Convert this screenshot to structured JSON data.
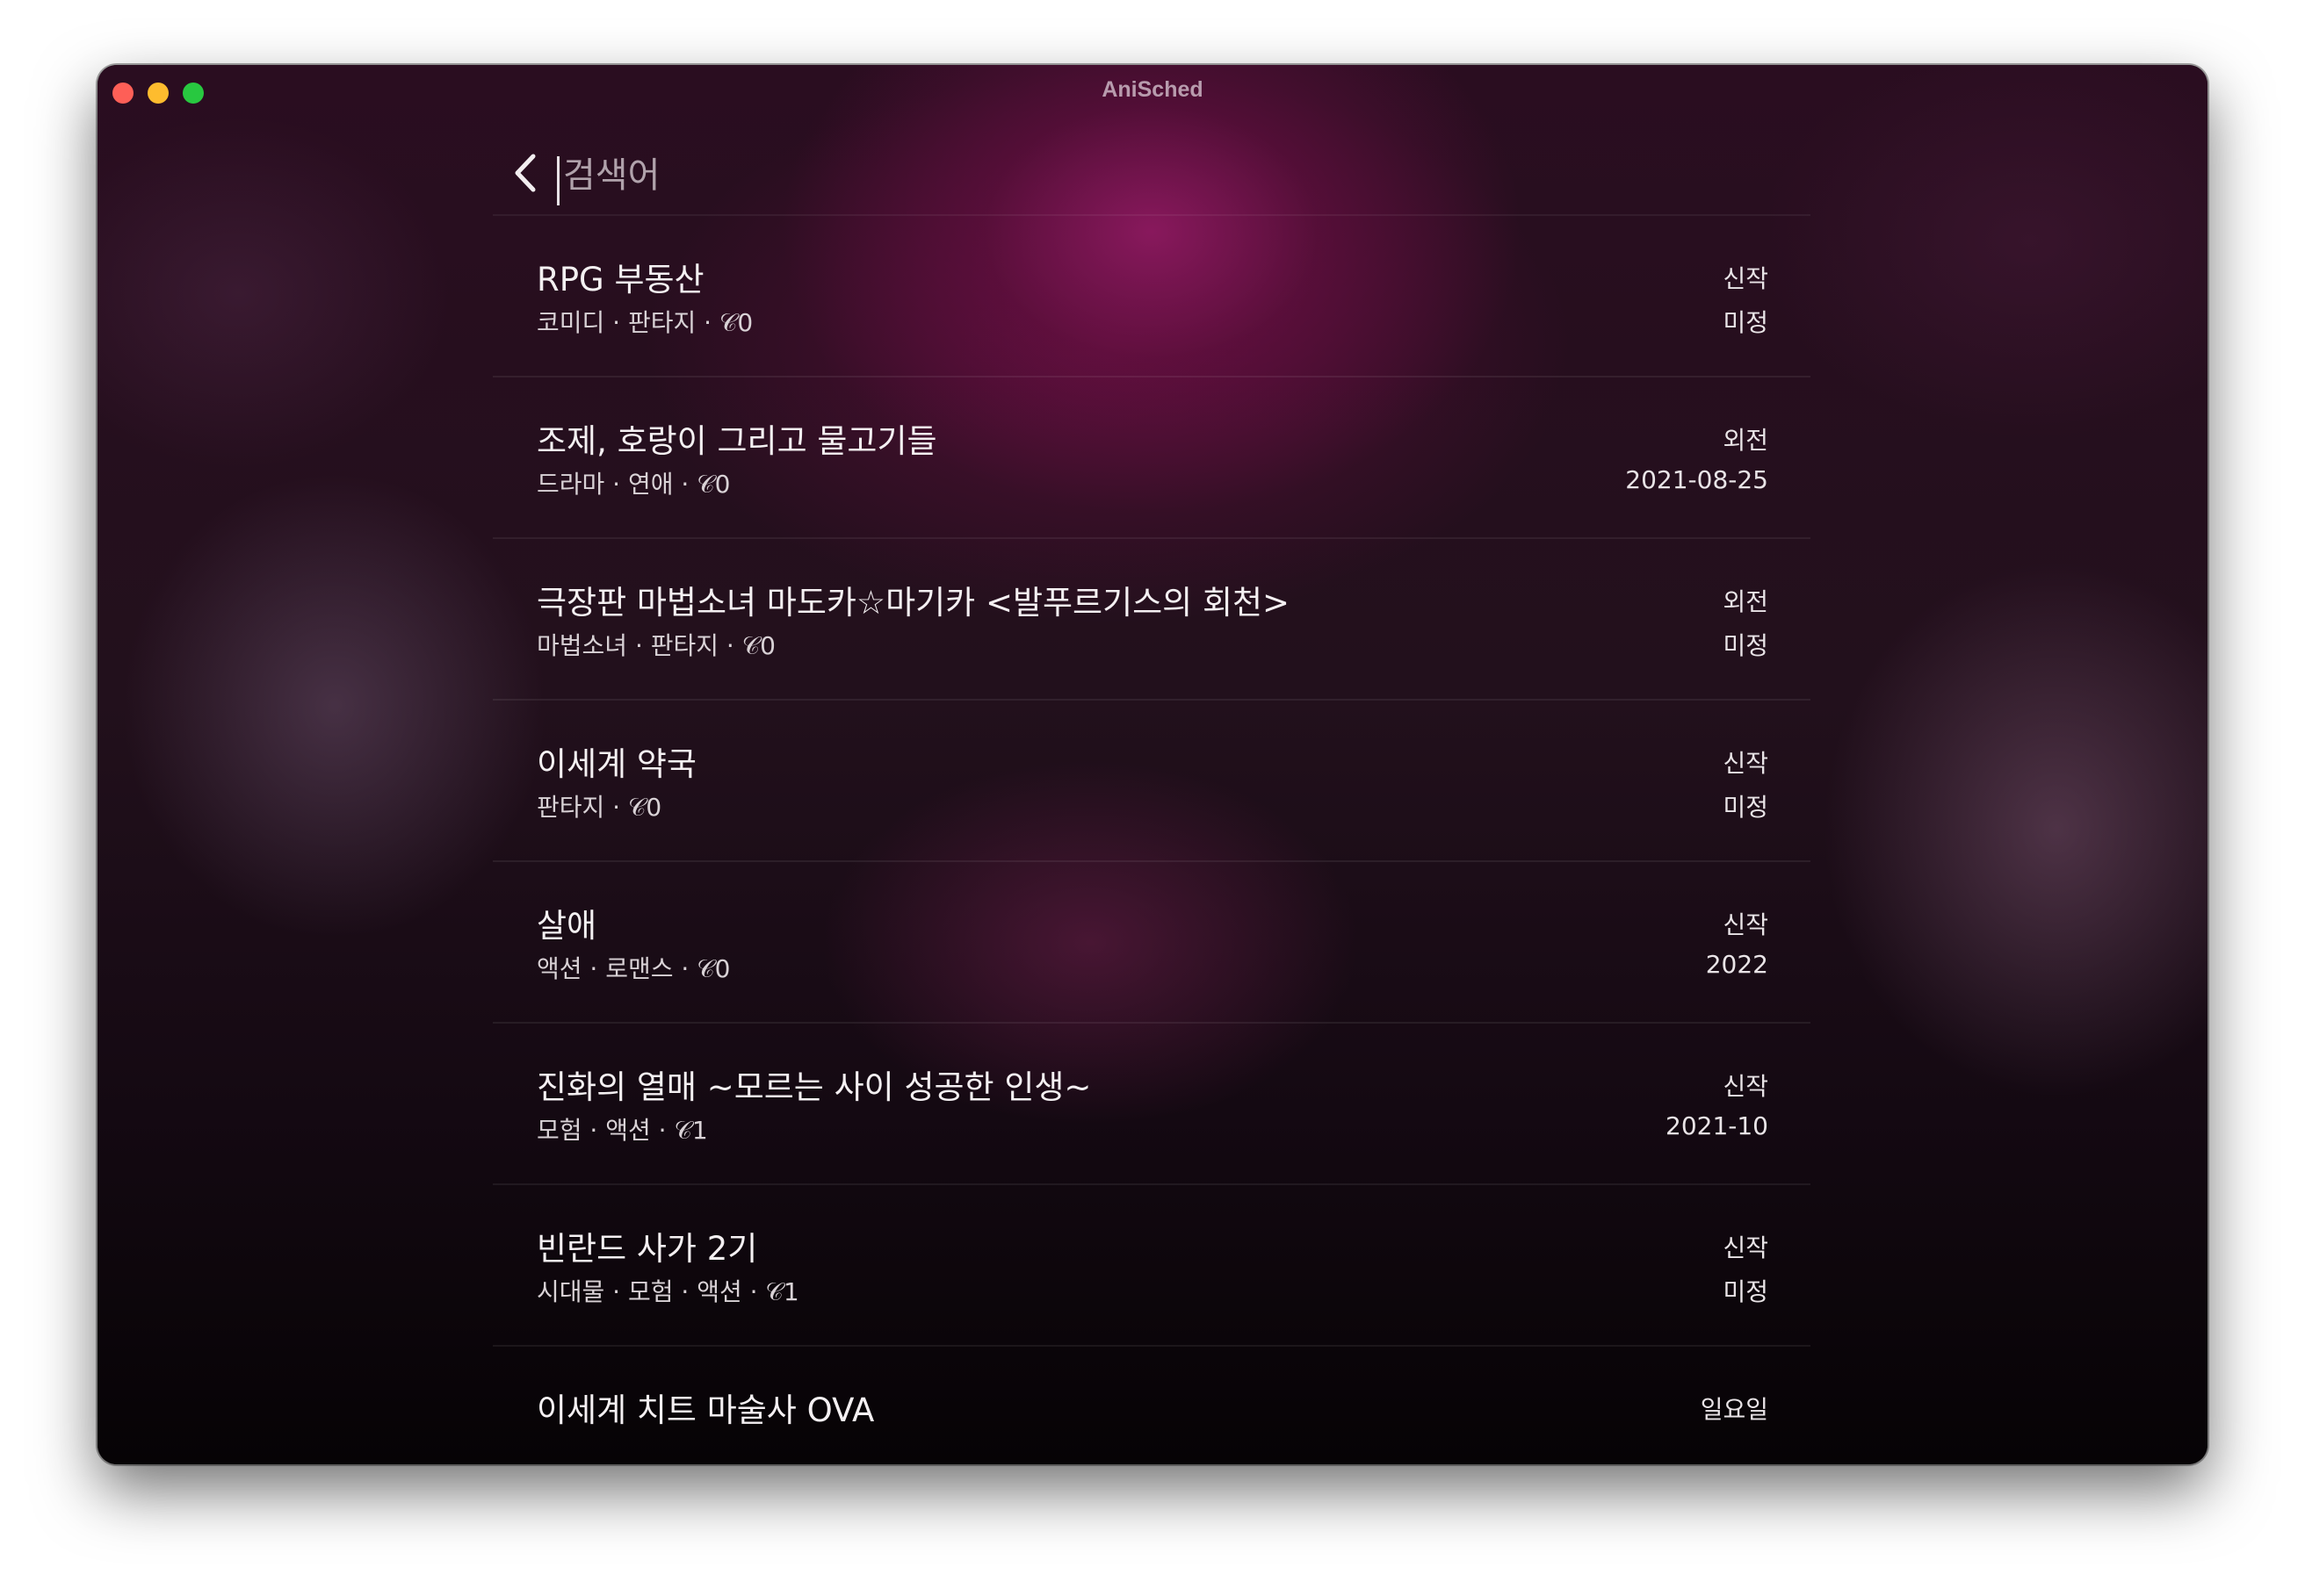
{
  "window": {
    "title": "AniSched"
  },
  "search": {
    "placeholder": "검색어",
    "value": ""
  },
  "results": [
    {
      "title": "RPG 부동산",
      "meta": "코미디 · 판타지 · 𝒞0",
      "status": "신작",
      "date": "미정"
    },
    {
      "title": "조제, 호랑이 그리고 물고기들",
      "meta": "드라마 · 연애 · 𝒞0",
      "status": "외전",
      "date": "2021-08-25"
    },
    {
      "title": "극장판 마법소녀 마도카☆마기카 <발푸르기스의 회천>",
      "meta": "마법소녀 · 판타지 · 𝒞0",
      "status": "외전",
      "date": "미정"
    },
    {
      "title": "이세계 약국",
      "meta": "판타지 · 𝒞0",
      "status": "신작",
      "date": "미정"
    },
    {
      "title": "살애",
      "meta": "액션 · 로맨스 · 𝒞0",
      "status": "신작",
      "date": "2022"
    },
    {
      "title": "진화의 열매 ~모르는 사이 성공한 인생~",
      "meta": "모험 · 액션 · 𝒞1",
      "status": "신작",
      "date": "2021-10"
    },
    {
      "title": "빈란드 사가 2기",
      "meta": "시대물 · 모험 · 액션 · 𝒞1",
      "status": "신작",
      "date": "미정"
    },
    {
      "title": "이세계 치트 마술사 OVA",
      "meta": "",
      "status": "일요일",
      "date": ""
    }
  ]
}
